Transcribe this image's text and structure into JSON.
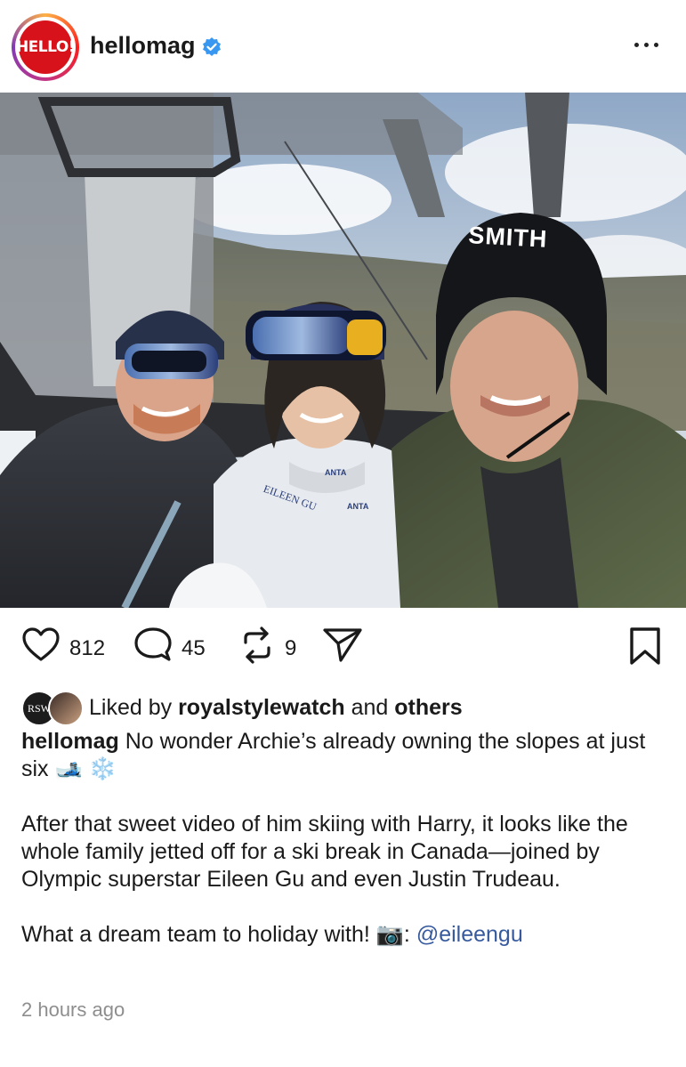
{
  "header": {
    "avatar_text": "HELLO!",
    "username": "hellomag",
    "verified": true,
    "more_icon": "more-horizontal-icon"
  },
  "photo": {
    "helmet_text": "SMITH",
    "jacket_text_1": "ANTA",
    "jacket_text_2": "ANTA",
    "jacket_logo": "EILEEN GU"
  },
  "actions": {
    "like_count": "812",
    "comment_count": "45",
    "repost_count": "9",
    "icons": [
      "heart-icon",
      "comment-icon",
      "repost-icon",
      "share-icon",
      "bookmark-icon"
    ]
  },
  "likes": {
    "avatar_1_text": "RSW",
    "prefix": "Liked by ",
    "user": "royalstylewatch",
    "middle": " and ",
    "others": "others"
  },
  "caption": {
    "author": "hellomag",
    "line1": " No wonder Archie’s already owning the slopes at just six 🎿 ❄️",
    "para2": "After that sweet video of him skiing with Harry, it looks like the whole family jetted off for a ski break in Canada—joined by Olympic superstar Eileen Gu and even Justin Trudeau.",
    "para3_text": "What a dream team to holiday with! 📷: ",
    "mention": "@eileengu"
  },
  "timestamp": "2 hours ago",
  "colors": {
    "brand_red": "#d8121b",
    "verified_blue": "#3897f0",
    "link_blue": "#375a9e",
    "muted": "#8e8e8e"
  }
}
